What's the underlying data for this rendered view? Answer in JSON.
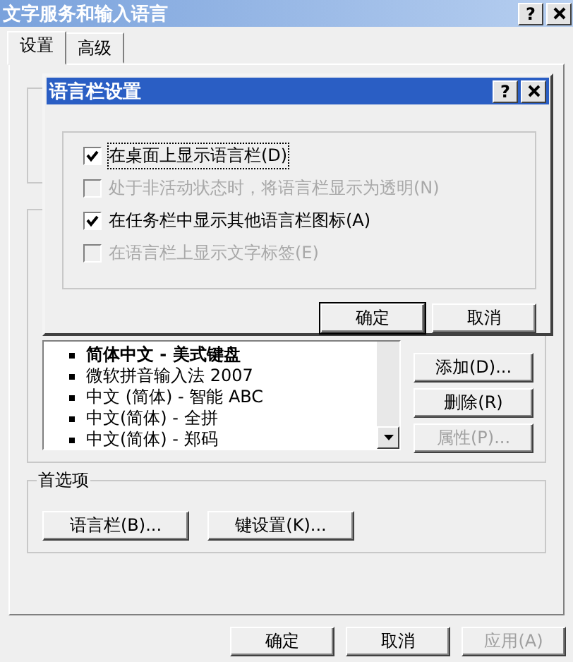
{
  "window": {
    "title": "文字服务和输入语言",
    "help": "?"
  },
  "tabs": [
    {
      "label": "设置",
      "selected": true
    },
    {
      "label": "高级",
      "selected": false
    }
  ],
  "installed_services": {
    "items": [
      {
        "label": "简体中文 - 美式键盘",
        "bold": true
      },
      {
        "label": "微软拼音输入法 2007",
        "bold": false
      },
      {
        "label": "中文 (简体) - 智能 ABC",
        "bold": false
      },
      {
        "label": "中文(简体) - 全拼",
        "bold": false
      },
      {
        "label": "中文(简体) - 郑码",
        "bold": false
      }
    ],
    "buttons": [
      {
        "label": "添加(D)...",
        "disabled": false
      },
      {
        "label": "删除(R)",
        "disabled": false
      },
      {
        "label": "属性(P)...",
        "disabled": true
      }
    ]
  },
  "preferences": {
    "title": "首选项",
    "buttons": [
      {
        "label": "语言栏(B)...",
        "disabled": false
      },
      {
        "label": "键设置(K)...",
        "disabled": false
      }
    ]
  },
  "buttons": [
    {
      "label": "确定",
      "disabled": false
    },
    {
      "label": "取消",
      "disabled": false
    },
    {
      "label": "应用(A)",
      "disabled": true
    }
  ],
  "dialog": {
    "title": "语言栏设置",
    "help": "?",
    "options": [
      {
        "label": "在桌面上显示语言栏(D)",
        "checked": true,
        "disabled": false,
        "focused": true
      },
      {
        "label": "处于非活动状态时，将语言栏显示为透明(N)",
        "checked": false,
        "disabled": true,
        "focused": false
      },
      {
        "label": "在任务栏中显示其他语言栏图标(A)",
        "checked": true,
        "disabled": false,
        "focused": false
      },
      {
        "label": "在语言栏上显示文字标签(E)",
        "checked": false,
        "disabled": true,
        "focused": false
      }
    ],
    "buttons": [
      {
        "label": "确定",
        "default": true
      },
      {
        "label": "取消",
        "default": false
      }
    ]
  }
}
